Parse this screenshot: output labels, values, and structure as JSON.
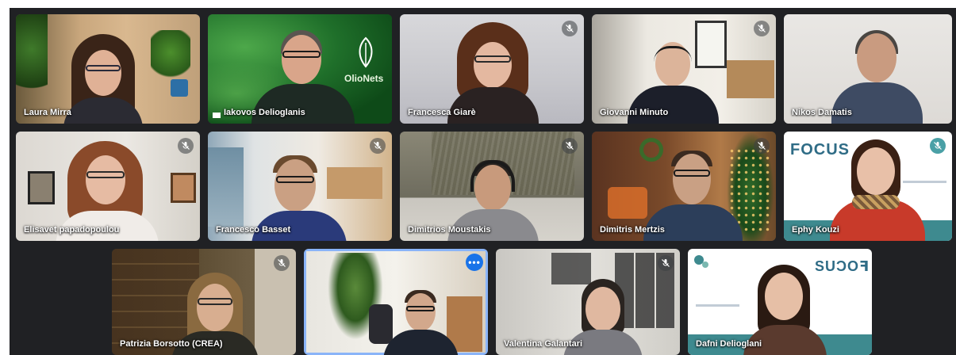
{
  "participants": [
    {
      "name": "Laura Mirra",
      "muted": false
    },
    {
      "name": "Iakovos Delioglanis",
      "muted": false
    },
    {
      "name": "Francesca Giarè",
      "muted": true
    },
    {
      "name": "Giovanni Minuto",
      "muted": true
    },
    {
      "name": "Nikos Damatis",
      "muted": false
    },
    {
      "name": "Elisavet papadopoulou",
      "muted": true
    },
    {
      "name": "Francesco Basset",
      "muted": true
    },
    {
      "name": "Dimitrios Moustakis",
      "muted": true
    },
    {
      "name": "Dimitris Mertzis",
      "muted": true
    },
    {
      "name": "Ephy Kouzi",
      "muted": true
    },
    {
      "name": "Patrizia Borsotto (CREA)",
      "muted": true
    },
    {
      "name": "",
      "muted": false
    },
    {
      "name": "Valentina Galantari",
      "muted": true
    },
    {
      "name": "Dafni Delioglani",
      "muted": false
    }
  ],
  "backgrounds": {
    "oliveneta_logo": "OlioNets",
    "focus_logo": "FOCUS",
    "focus_logo_mirrored": "SUϽOꟻ"
  },
  "icons": {
    "mute": "mic-off-icon",
    "options": "more-options-icon",
    "options_glyph": "•••"
  },
  "colors": {
    "meeting_bg": "#202124",
    "active_border": "#8ab4f8",
    "options_button": "#1a73e8"
  }
}
